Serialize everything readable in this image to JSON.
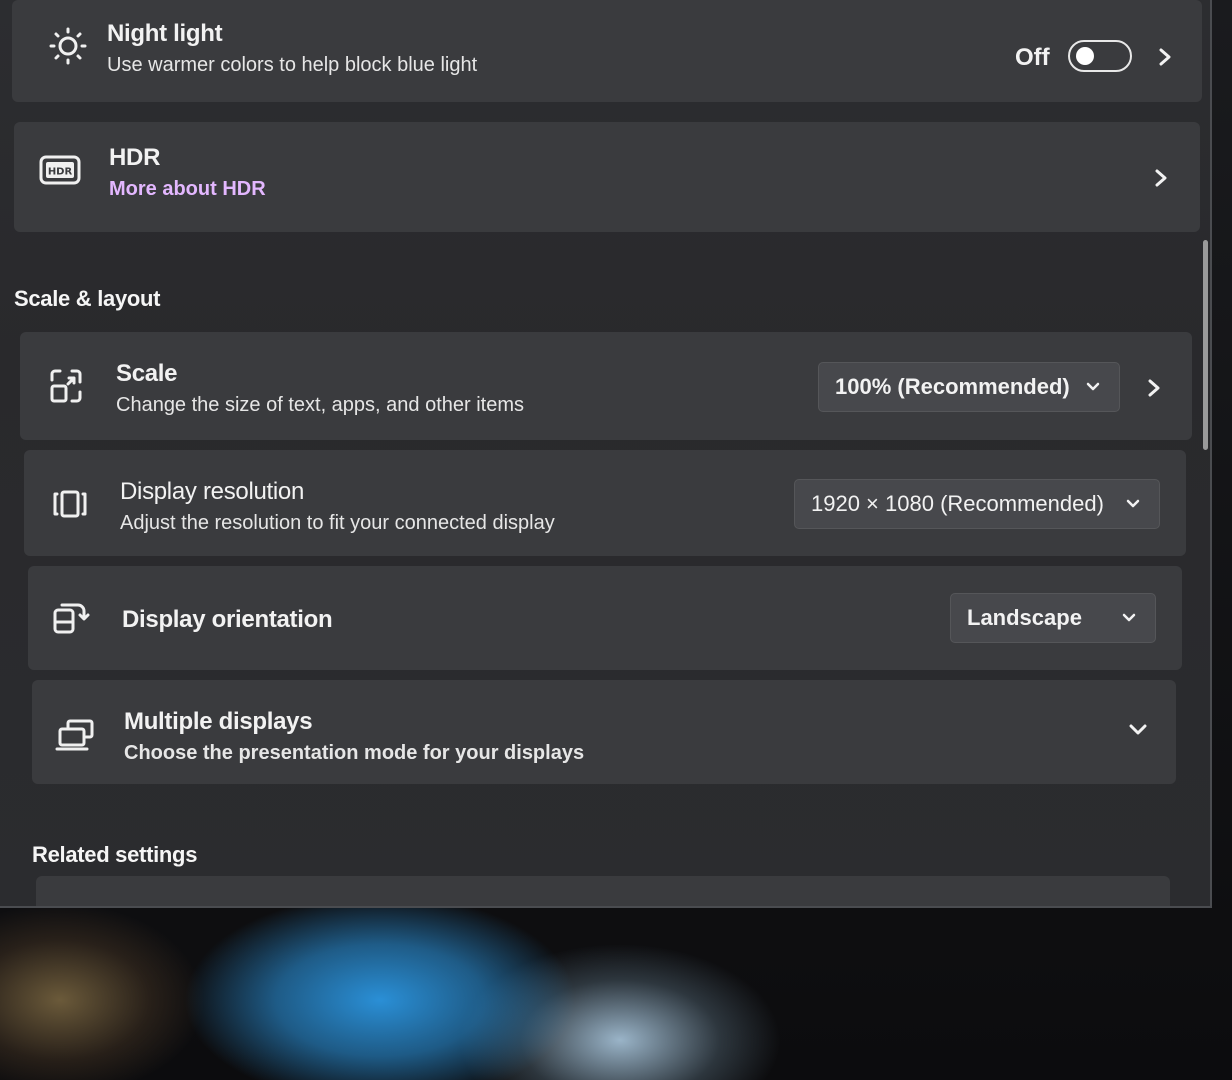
{
  "night_light": {
    "title": "Night light",
    "subtitle": "Use warmer colors to help block blue light",
    "toggle_state": "Off",
    "icon": "sun-icon"
  },
  "hdr": {
    "title": "HDR",
    "link": "More about HDR",
    "icon": "hdr-icon"
  },
  "scale_layout": {
    "heading": "Scale & layout",
    "scale": {
      "title": "Scale",
      "subtitle": "Change the size of text, apps, and other items",
      "value": "100% (Recommended)",
      "icon": "scale-icon"
    },
    "resolution": {
      "title": "Display resolution",
      "subtitle": "Adjust the resolution to fit your connected display",
      "value": "1920 × 1080 (Recommended)",
      "icon": "resolution-icon"
    },
    "orientation": {
      "title": "Display orientation",
      "value": "Landscape",
      "icon": "rotate-icon"
    },
    "multiple_displays": {
      "title": "Multiple displays",
      "subtitle": "Choose the presentation mode for your displays",
      "icon": "multiple-displays-icon"
    }
  },
  "related": {
    "heading": "Related settings"
  },
  "colors": {
    "window_bg": "#2b2c2f",
    "card_bg": "#3a3b3e",
    "link": "#e3b7ff"
  }
}
